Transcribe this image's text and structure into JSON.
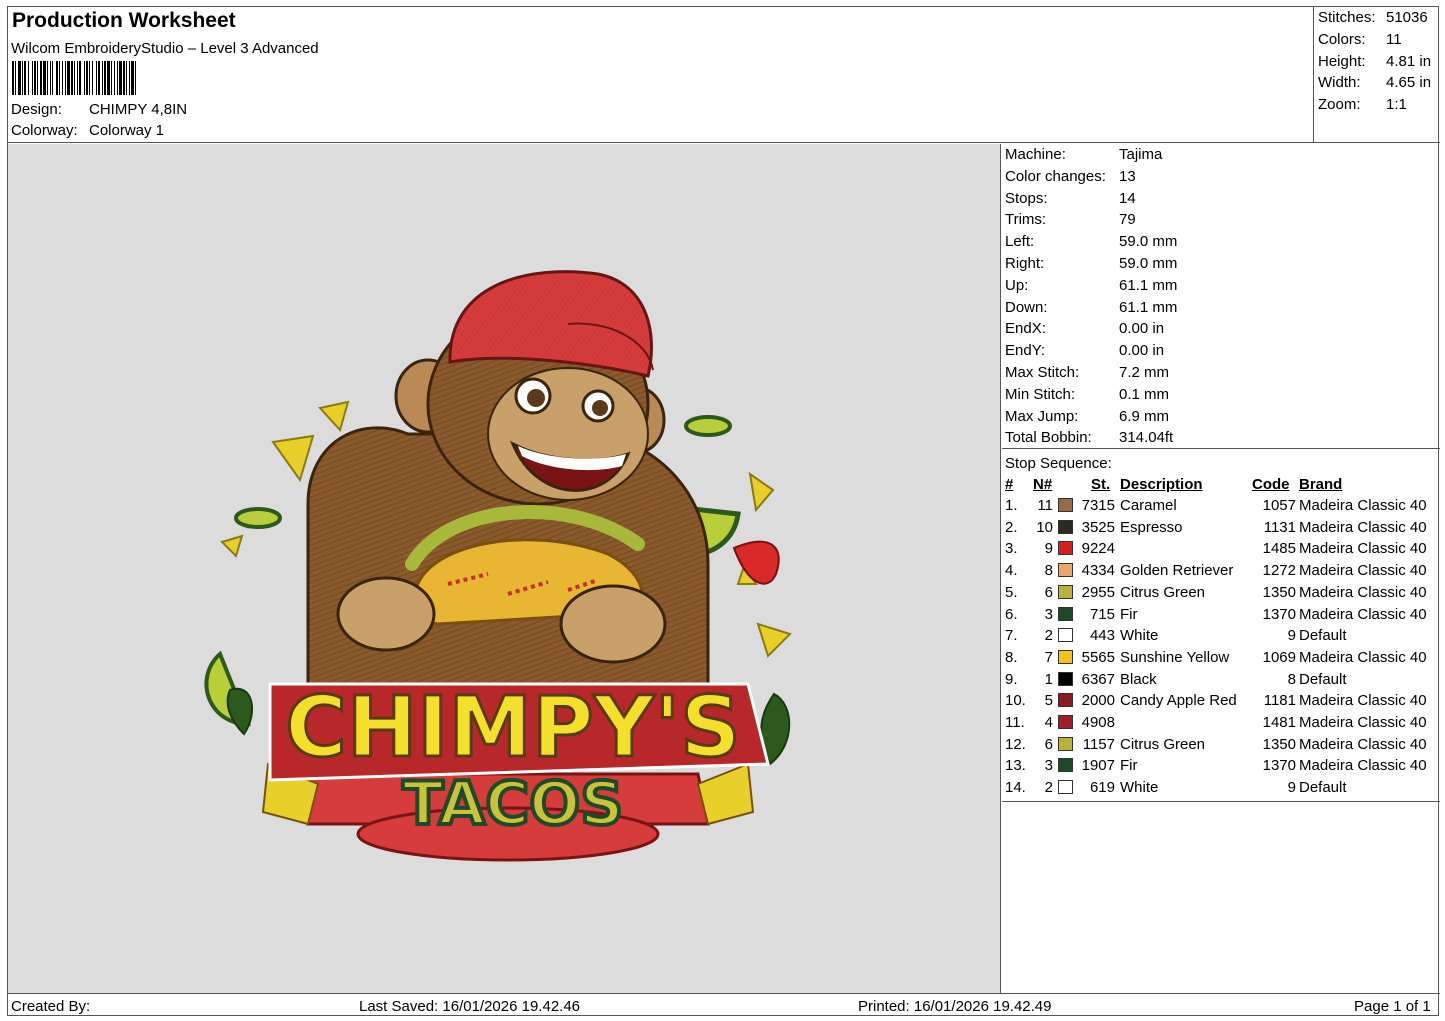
{
  "header": {
    "title": "Production Worksheet",
    "app": "Wilcom EmbroideryStudio – Level 3 Advanced",
    "design_label": "Design:",
    "design_value": "CHIMPY 4,8IN",
    "colorway_label": "Colorway:",
    "colorway_value": "Colorway 1"
  },
  "header_stats": [
    {
      "label": "Stitches:",
      "value": "51036"
    },
    {
      "label": "Colors:",
      "value": "11"
    },
    {
      "label": "Height:",
      "value": "4.81 in"
    },
    {
      "label": "Width:",
      "value": "4.65 in"
    },
    {
      "label": "Zoom:",
      "value": "1:1"
    }
  ],
  "machine_info": [
    {
      "label": "Machine:",
      "value": "Tajima"
    },
    {
      "label": "Color changes:",
      "value": "13"
    },
    {
      "label": "Stops:",
      "value": "14"
    },
    {
      "label": "Trims:",
      "value": "79"
    },
    {
      "label": "Left:",
      "value": "59.0 mm"
    },
    {
      "label": "Right:",
      "value": "59.0 mm"
    },
    {
      "label": "Up:",
      "value": "61.1 mm"
    },
    {
      "label": "Down:",
      "value": "61.1 mm"
    },
    {
      "label": "EndX:",
      "value": "0.00 in"
    },
    {
      "label": "EndY:",
      "value": "0.00 in"
    },
    {
      "label": "Max Stitch:",
      "value": "7.2 mm"
    },
    {
      "label": "Min Stitch:",
      "value": "0.1 mm"
    },
    {
      "label": "Max Jump:",
      "value": "6.9 mm"
    },
    {
      "label": "Total Bobbin:",
      "value": "314.04ft"
    }
  ],
  "stop_sequence": {
    "title": "Stop Sequence:",
    "headers": {
      "stop": "#",
      "needle": "N#",
      "stitches": "St.",
      "description": "Description",
      "code": "Code",
      "brand": "Brand"
    },
    "rows": [
      {
        "stop": "1.",
        "needle": "11",
        "stitches": "7315",
        "color": "#9a6b43",
        "description": "Caramel",
        "code": "1057",
        "brand": "Madeira Classic 40"
      },
      {
        "stop": "2.",
        "needle": "10",
        "stitches": "3525",
        "color": "#2b2a22",
        "description": "Espresso",
        "code": "1131",
        "brand": "Madeira Classic 40"
      },
      {
        "stop": "3.",
        "needle": "9",
        "stitches": "9224",
        "color": "#d42020",
        "description": "",
        "code": "1485",
        "brand": "Madeira Classic 40"
      },
      {
        "stop": "4.",
        "needle": "8",
        "stitches": "4334",
        "color": "#e7a86a",
        "description": "Golden Retriever",
        "code": "1272",
        "brand": "Madeira Classic 40"
      },
      {
        "stop": "5.",
        "needle": "6",
        "stitches": "2955",
        "color": "#b7b23a",
        "description": "Citrus Green",
        "code": "1350",
        "brand": "Madeira Classic 40"
      },
      {
        "stop": "6.",
        "needle": "3",
        "stitches": "715",
        "color": "#1e4a2a",
        "description": "Fir",
        "code": "1370",
        "brand": "Madeira Classic 40"
      },
      {
        "stop": "7.",
        "needle": "2",
        "stitches": "443",
        "color": "#ffffff",
        "description": "White",
        "code": "9",
        "brand": "Default"
      },
      {
        "stop": "8.",
        "needle": "7",
        "stitches": "5565",
        "color": "#f6c21a",
        "description": "Sunshine Yellow",
        "code": "1069",
        "brand": "Madeira Classic 40"
      },
      {
        "stop": "9.",
        "needle": "1",
        "stitches": "6367",
        "color": "#000000",
        "description": "Black",
        "code": "8",
        "brand": "Default"
      },
      {
        "stop": "10.",
        "needle": "5",
        "stitches": "2000",
        "color": "#8c1a1e",
        "description": "Candy Apple Red",
        "code": "1181",
        "brand": "Madeira Classic 40"
      },
      {
        "stop": "11.",
        "needle": "4",
        "stitches": "4908",
        "color": "#a01c28",
        "description": "",
        "code": "1481",
        "brand": "Madeira Classic 40"
      },
      {
        "stop": "12.",
        "needle": "6",
        "stitches": "1157",
        "color": "#b7b23a",
        "description": "Citrus Green",
        "code": "1350",
        "brand": "Madeira Classic 40"
      },
      {
        "stop": "13.",
        "needle": "3",
        "stitches": "1907",
        "color": "#1e4a2a",
        "description": "Fir",
        "code": "1370",
        "brand": "Madeira Classic 40"
      },
      {
        "stop": "14.",
        "needle": "2",
        "stitches": "619",
        "color": "#ffffff",
        "description": "White",
        "code": "9",
        "brand": "Default"
      }
    ]
  },
  "design_art": {
    "title_line1": "CHIMPY'S",
    "title_line2": "TACOS"
  },
  "footer": {
    "created_by": "Created By:",
    "last_saved": "Last Saved: 16/01/2026 19.42.46",
    "printed": "Printed: 16/01/2026 19.42.49",
    "page": "Page 1 of 1"
  }
}
